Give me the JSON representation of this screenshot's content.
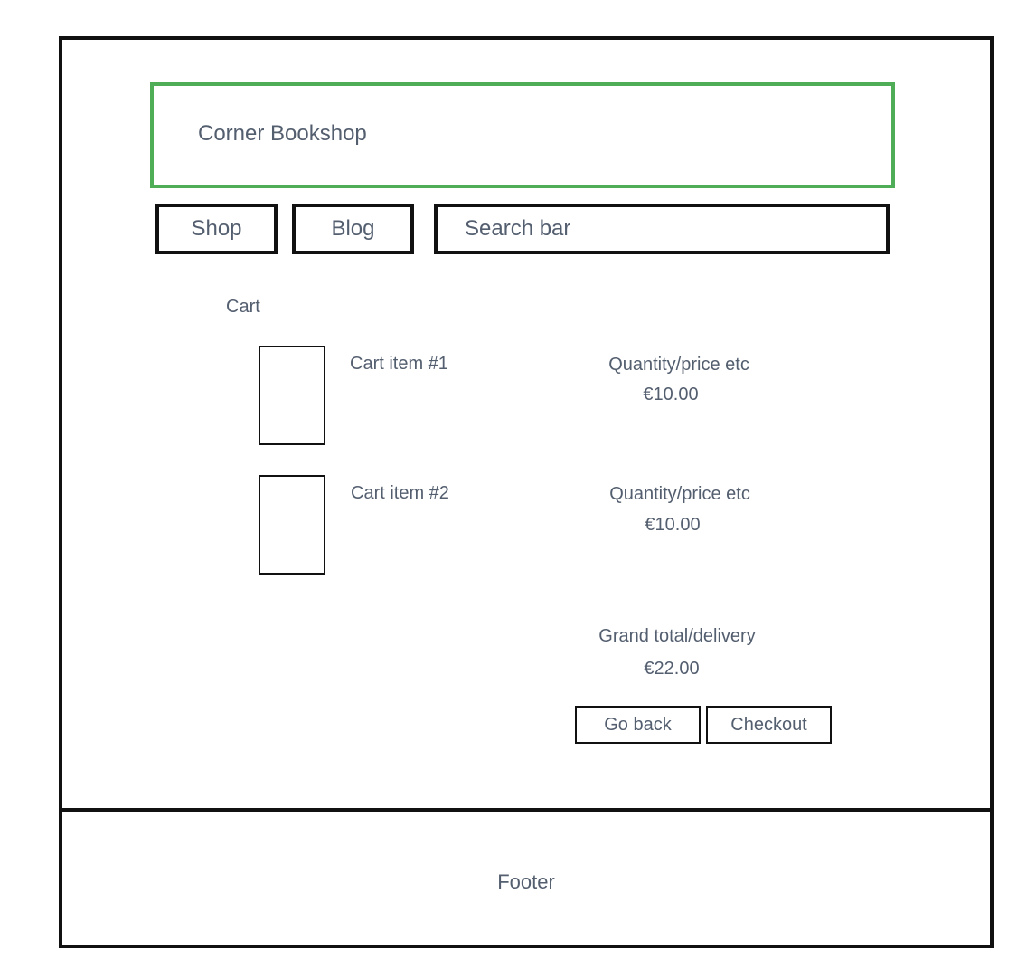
{
  "header": {
    "title": "Corner Bookshop"
  },
  "nav": {
    "shop_label": "Shop",
    "blog_label": "Blog",
    "search_label": "Search bar"
  },
  "cart": {
    "heading": "Cart",
    "items": [
      {
        "label": "Cart item #1",
        "details": "Quantity/price etc",
        "price": "€10.00"
      },
      {
        "label": "Cart item #2",
        "details": "Quantity/price etc",
        "price": "€10.00"
      }
    ],
    "grand_total_label": "Grand total/delivery",
    "grand_total_value": "€22.00",
    "go_back_label": "Go back",
    "checkout_label": "Checkout"
  },
  "footer": {
    "label": "Footer"
  },
  "colors": {
    "header_border": "#4fad57",
    "text": "#535e6f",
    "outline": "#111111"
  }
}
